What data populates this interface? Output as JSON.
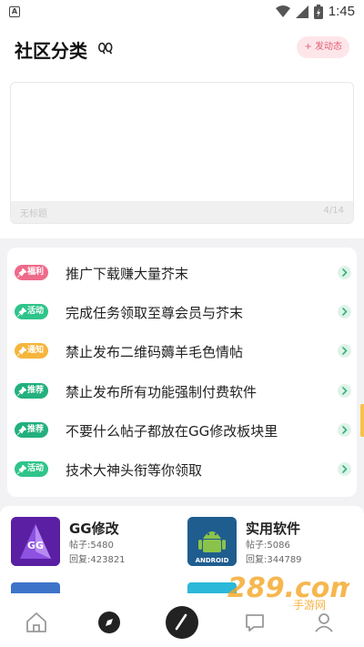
{
  "status_bar": {
    "time": "1:45",
    "app_icon_letter": "A"
  },
  "header": {
    "title": "社区分类",
    "post_button": "+ 发动态"
  },
  "banner": {
    "caption": "无标题",
    "counter": "4/14"
  },
  "notices": [
    {
      "tag": "福利",
      "tag_color": "#ef6a8a",
      "text": "推广下载赚大量芥末"
    },
    {
      "tag": "活动",
      "tag_color": "#2fc48a",
      "text": "完成任务领取至尊会员与芥末"
    },
    {
      "tag": "通知",
      "tag_color": "#f5b53c",
      "text": "禁止发布二维码薅羊毛色情帖"
    },
    {
      "tag": "推荐",
      "tag_color": "#22b07e",
      "text": "禁止发布所有功能强制付费软件"
    },
    {
      "tag": "推荐",
      "tag_color": "#22b07e",
      "text": "不要什么帖子都放在GG修改板块里"
    },
    {
      "tag": "活动",
      "tag_color": "#2fc48a",
      "text": "技术大神头衔等你领取"
    }
  ],
  "categories": [
    {
      "name": "GG修改",
      "posts": "帖子:5480",
      "replies": "回复:423821",
      "logo_text": "GG",
      "logo_color": "#6b2bb8"
    },
    {
      "name": "实用软件",
      "posts": "帖子:5086",
      "replies": "回复:344789",
      "logo_text": "ANDROID",
      "logo_color": "#1f5d8f"
    }
  ],
  "watermark": {
    "text": "289.com",
    "sub": "手游网"
  },
  "colors": {
    "accent_pink": "#e35d73",
    "arrow_green": "#33b37c"
  }
}
